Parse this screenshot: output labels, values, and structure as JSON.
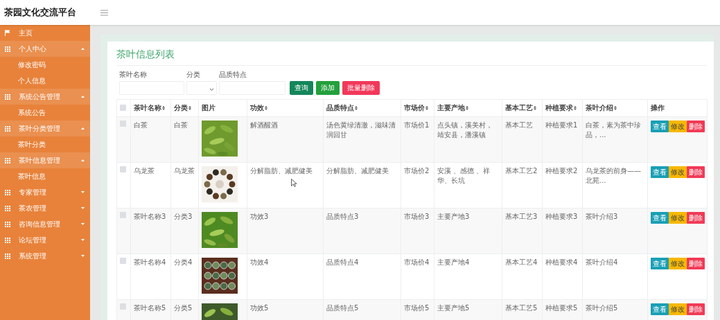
{
  "app": {
    "title": "茶园文化交流平台"
  },
  "sidebar": {
    "items": [
      {
        "label": "主页"
      },
      {
        "label": "个人中心",
        "expanded": true,
        "children": [
          {
            "label": "修改密码"
          },
          {
            "label": "个人信息"
          }
        ]
      },
      {
        "label": "系统公告管理",
        "expanded": true,
        "children": [
          {
            "label": "系统公告"
          }
        ]
      },
      {
        "label": "茶叶分类管理",
        "expanded": true,
        "children": [
          {
            "label": "茶叶分类"
          }
        ]
      },
      {
        "label": "茶叶信息管理",
        "expanded": true,
        "children": [
          {
            "label": "茶叶信息"
          }
        ]
      },
      {
        "label": "专家管理",
        "expanded": false
      },
      {
        "label": "茶农管理",
        "expanded": false
      },
      {
        "label": "咨询信息管理",
        "expanded": false
      },
      {
        "label": "论坛管理",
        "expanded": false
      },
      {
        "label": "系统管理",
        "expanded": false
      }
    ]
  },
  "page": {
    "title": "茶叶信息列表"
  },
  "filters": [
    {
      "kind": "text",
      "label": "茶叶名称"
    },
    {
      "kind": "select",
      "label": "分类"
    },
    {
      "kind": "text",
      "label": "品质特点"
    }
  ],
  "filter_buttons": [
    {
      "kind": "search",
      "label": "查询"
    },
    {
      "kind": "add",
      "label": "添加"
    },
    {
      "kind": "delete",
      "label": "批量删除"
    }
  ],
  "table": {
    "select_all": {
      "checked": false
    },
    "columns": [
      {
        "label": "茶叶名称",
        "sortable": true
      },
      {
        "label": "分类",
        "sortable": true
      },
      {
        "label": "图片",
        "sortable": false
      },
      {
        "label": "功效",
        "sortable": true
      },
      {
        "label": "品质特点",
        "sortable": true
      },
      {
        "label": "市场价",
        "sortable": true
      },
      {
        "label": "主要产地",
        "sortable": true
      },
      {
        "label": "基本工艺",
        "sortable": true
      },
      {
        "label": "种植要求",
        "sortable": true
      },
      {
        "label": "茶叶介绍",
        "sortable": true
      },
      {
        "label": "操作",
        "sortable": false
      }
    ],
    "rows": [
      {
        "checked": false,
        "cells": [
          "白茶",
          "白茶",
          "",
          "解酒醒酒",
          "汤色黄绿清澈，滋味清润回甘",
          "市场价1",
          "点头镇，溪美村，靖安县，潘溪镇",
          "基本工艺",
          "种植要求1",
          "白茶，素为茶中珍品，..."
        ],
        "actions": [
          {
            "kind": "view",
            "label": "查看"
          },
          {
            "kind": "edit",
            "label": "修改"
          },
          {
            "kind": "delete",
            "label": "删除"
          }
        ]
      },
      {
        "checked": false,
        "cells": [
          "乌龙茶",
          "乌龙茶",
          "",
          "分解脂肪、减肥健美",
          "分解脂肪、减肥健美",
          "市场价2",
          "安溪 、感德 、祥华、长坑",
          "基本工艺2",
          "种植要求2",
          "乌龙茶的前身——北苑..."
        ],
        "actions": [
          {
            "kind": "view",
            "label": "查看"
          },
          {
            "kind": "edit",
            "label": "修改"
          },
          {
            "kind": "delete",
            "label": "删除"
          }
        ]
      },
      {
        "checked": false,
        "cells": [
          "茶叶名称3",
          "分类3",
          "",
          "功效3",
          "品质特点3",
          "市场价3",
          "主要产地3",
          "基本工艺3",
          "种植要求3",
          "茶叶介绍3"
        ],
        "actions": [
          {
            "kind": "view",
            "label": "查看"
          },
          {
            "kind": "edit",
            "label": "修改"
          },
          {
            "kind": "delete",
            "label": "删除"
          }
        ]
      },
      {
        "checked": false,
        "cells": [
          "茶叶名称4",
          "分类4",
          "",
          "功效4",
          "品质特点4",
          "市场价4",
          "主要产地4",
          "基本工艺4",
          "种植要求4",
          "茶叶介绍4"
        ],
        "actions": [
          {
            "kind": "view",
            "label": "查看"
          },
          {
            "kind": "edit",
            "label": "修改"
          },
          {
            "kind": "delete",
            "label": "删除"
          }
        ]
      },
      {
        "checked": false,
        "cells": [
          "茶叶名称5",
          "分类5",
          "",
          "功效5",
          "品质特点5",
          "市场价5",
          "主要产地5",
          "基本工艺5",
          "种植要求5",
          "茶叶介绍5"
        ],
        "actions": [
          {
            "kind": "view",
            "label": "查看"
          },
          {
            "kind": "edit",
            "label": "修改"
          },
          {
            "kind": "delete",
            "label": "删除"
          }
        ]
      }
    ]
  }
}
